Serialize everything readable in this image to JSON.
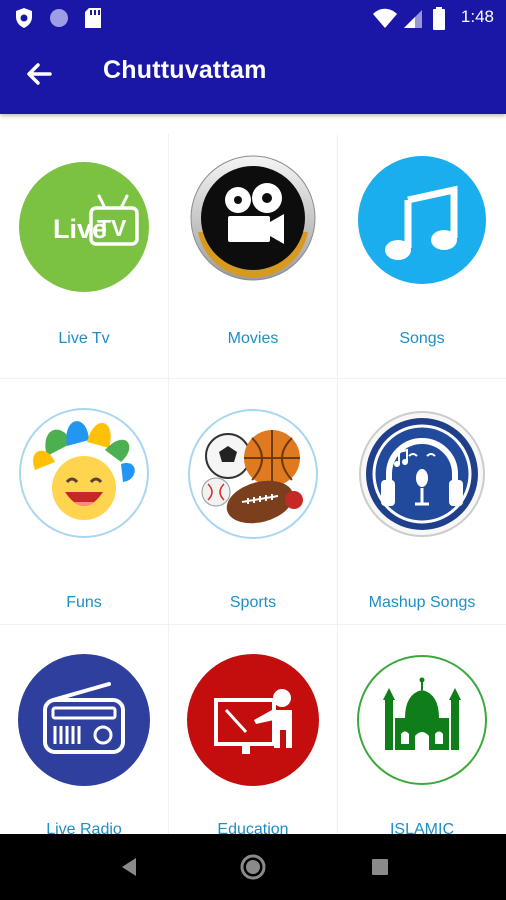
{
  "status_bar": {
    "time": "1:48",
    "icons": [
      "shield-icon",
      "circle-icon",
      "sd-card-icon",
      "wifi-icon",
      "signal-icon",
      "battery-icon"
    ]
  },
  "app_bar": {
    "title": "Chuttuvattam",
    "back_icon": "arrow-back-icon"
  },
  "grid": {
    "items": [
      {
        "label": "Live Tv",
        "icon": "live-tv-icon"
      },
      {
        "label": "Movies",
        "icon": "movie-camera-icon"
      },
      {
        "label": "Songs",
        "icon": "music-note-icon"
      },
      {
        "label": "Funs",
        "icon": "laughing-face-icon"
      },
      {
        "label": "Sports",
        "icon": "sports-balls-icon"
      },
      {
        "label": "Mashup Songs",
        "icon": "headphones-icon"
      },
      {
        "label": "Live Radio",
        "icon": "radio-icon"
      },
      {
        "label": "Education",
        "icon": "teacher-board-icon"
      },
      {
        "label": "ISLAMIC",
        "icon": "mosque-icon"
      }
    ]
  },
  "nav_bar": {
    "back": "nav-back-icon",
    "home": "nav-home-icon",
    "recents": "nav-recents-icon"
  },
  "colors": {
    "primary": "#1a17a6",
    "label": "#1f8ec6"
  }
}
